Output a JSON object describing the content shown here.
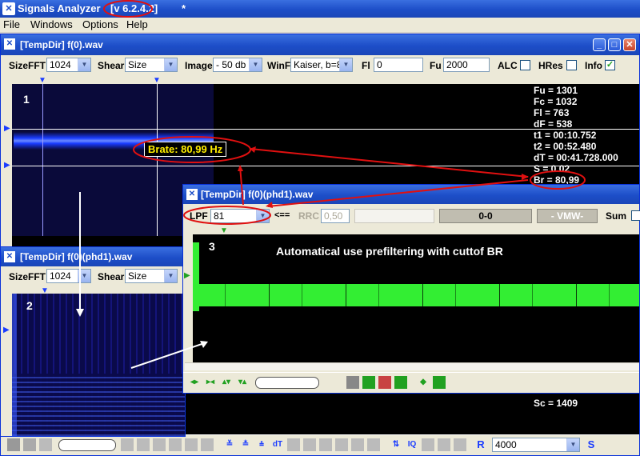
{
  "app": {
    "name": "Signals Analyzer",
    "version": "[v 6.2.4.2]",
    "modified_mark": "*"
  },
  "menu": [
    "File",
    "Windows",
    "Options",
    "Help"
  ],
  "window1": {
    "title": "[TempDir] f(0).wav",
    "toolbar": {
      "sizefft_label": "SizeFFT",
      "sizefft_value": "1024",
      "shear_label": "Shear",
      "shear_value": "Size",
      "image_label": "Image",
      "image_value": "- 50 db",
      "winf_label": "WinF",
      "winf_value": "Kaiser, b=8",
      "fl_label": "Fl",
      "fl_value": "0",
      "fu_label": "Fu",
      "fu_value": "2000",
      "alc_label": "ALC",
      "alc_checked": false,
      "hres_label": "HRes",
      "hres_checked": false,
      "info_label": "Info",
      "info_checked": true
    },
    "panel_number": "1",
    "brate_label": "Brate: 80,99 Hz",
    "readouts": [
      "Fu = 1301",
      "Fc = 1032",
      "Fl = 763",
      "dF = 538",
      "t1 = 00:10.752",
      "t2 = 00:52.480",
      "dT = 00:41.728.000",
      "S = 0.02"
    ],
    "br_readout": "Br = 80,99",
    "sc_readout": "Sc = 1409",
    "bottom_select_value": "4000"
  },
  "window2": {
    "title": "[TempDir] f(0)(phd1).wav",
    "toolbar": {
      "sizefft_label": "SizeFFT",
      "sizefft_value": "1024",
      "shear_label": "Shear",
      "shear_value": "Size"
    },
    "panel_number": "2"
  },
  "window3": {
    "title": "[TempDir] f(0)(phd1).wav",
    "toolbar": {
      "lpf_label": "LPF",
      "lpf_value": "81",
      "arrow_label": "<==",
      "rrc_label": "RRC",
      "rrc_value": "0,50",
      "range_label": "0-0",
      "vmw_label": "- VMW-",
      "sum_label": "Sum"
    },
    "panel_number": "3",
    "caption": "Automatical use prefiltering with cuttof BR"
  },
  "colors": {
    "title_blue": "#1d4ec8",
    "signal_green": "#33ee33",
    "annotation_red": "#e01010",
    "spectrum_blue": "#1a3cff"
  }
}
